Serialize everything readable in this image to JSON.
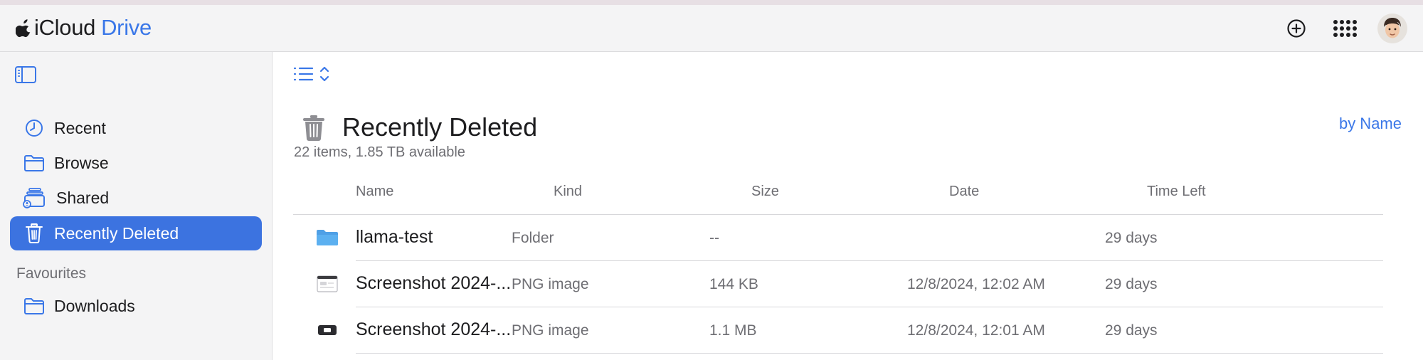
{
  "header": {
    "brand_icloud": "iCloud",
    "brand_drive": "Drive",
    "add_icon": "plus-circle-icon",
    "apps_icon": "grid-icon",
    "avatar_icon": "memoji-avatar"
  },
  "sidebar": {
    "toggle_icon": "sidebar-icon",
    "items": [
      {
        "label": "Recent",
        "icon": "clock-icon"
      },
      {
        "label": "Browse",
        "icon": "folder-icon"
      },
      {
        "label": "Shared",
        "icon": "shared-folder-icon"
      },
      {
        "label": "Recently Deleted",
        "icon": "trash-icon",
        "active": true
      }
    ],
    "favourites_label": "Favourites",
    "favourites": [
      {
        "label": "Downloads",
        "icon": "folder-icon"
      }
    ]
  },
  "main": {
    "view_toggle_icon": "list-view-icon",
    "title": "Recently Deleted",
    "summary": "22 items, 1.85 TB available",
    "sort_label": "by Name",
    "columns": [
      "Name",
      "Kind",
      "Size",
      "Date",
      "Time Left"
    ],
    "rows": [
      {
        "name": "llama-test",
        "kind": "Folder",
        "size": "--",
        "date": "",
        "time_left": "29 days",
        "icon": "folder-icon"
      },
      {
        "name": "Screenshot 2024-...",
        "kind": "PNG image",
        "size": "144 KB",
        "date": "12/8/2024, 12:02 AM",
        "time_left": "29 days",
        "icon": "image-thumbnail-icon"
      },
      {
        "name": "Screenshot 2024-...",
        "kind": "PNG image",
        "size": "1.1 MB",
        "date": "12/8/2024, 12:01 AM",
        "time_left": "29 days",
        "icon": "image-thumbnail-icon"
      }
    ]
  },
  "colors": {
    "accent": "#3a77e8",
    "active_bg": "#3c73e0",
    "sidebar_bg": "#f4f4f5",
    "secondary_text": "#6e6e73"
  }
}
